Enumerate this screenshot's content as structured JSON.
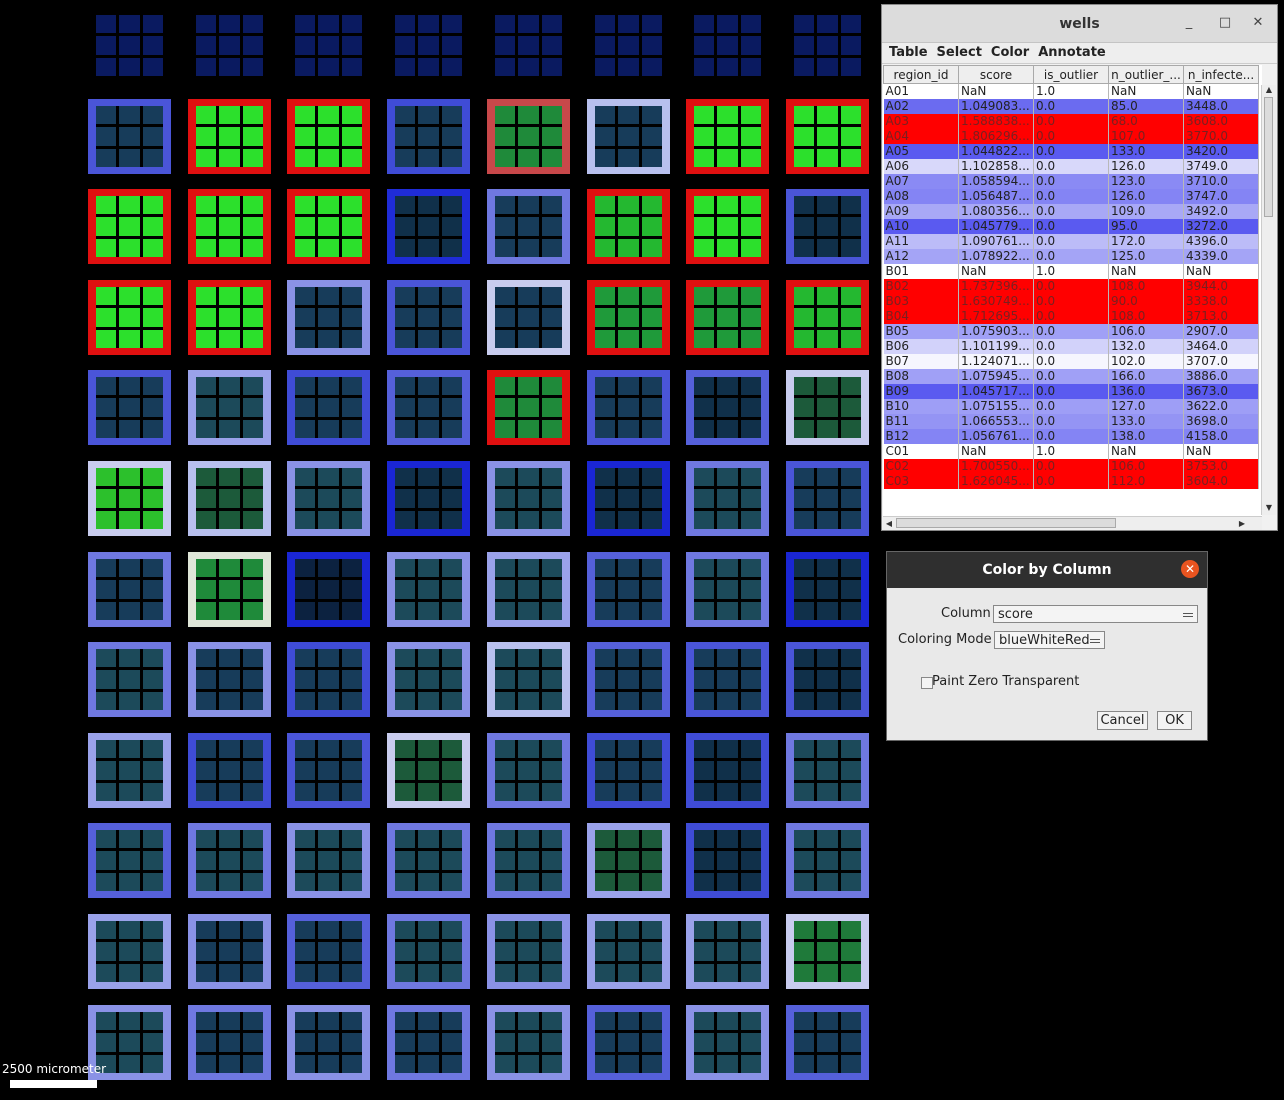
{
  "plate": {
    "scale_label": "2500 micrometer",
    "wells": [
      {
        "id": "r0c0",
        "row": 0,
        "col": 0,
        "frame": "#000000",
        "fill": "#0a1a60"
      },
      {
        "id": "r0c1",
        "row": 0,
        "col": 1,
        "frame": "#000000",
        "fill": "#0a1a60"
      },
      {
        "id": "r0c2",
        "row": 0,
        "col": 2,
        "frame": "#000000",
        "fill": "#0a1a60"
      },
      {
        "id": "r0c3",
        "row": 0,
        "col": 3,
        "frame": "#000000",
        "fill": "#0a1a60"
      },
      {
        "id": "r0c4",
        "row": 0,
        "col": 4,
        "frame": "#000000",
        "fill": "#0a1a60"
      },
      {
        "id": "r0c5",
        "row": 0,
        "col": 5,
        "frame": "#000000",
        "fill": "#0a1a60"
      },
      {
        "id": "r0c6",
        "row": 0,
        "col": 6,
        "frame": "#000000",
        "fill": "#0a1a60"
      },
      {
        "id": "r0c7",
        "row": 0,
        "col": 7,
        "frame": "#000000",
        "fill": "#0a1a60"
      },
      {
        "id": "r1c0",
        "row": 1,
        "col": 0,
        "frame": "#4a55d8",
        "fill": "#173c5a"
      },
      {
        "id": "r1c1",
        "row": 1,
        "col": 1,
        "frame": "#e01010",
        "fill": "#2ce02c"
      },
      {
        "id": "r1c2",
        "row": 1,
        "col": 2,
        "frame": "#e01010",
        "fill": "#2ce02c"
      },
      {
        "id": "r1c3",
        "row": 1,
        "col": 3,
        "frame": "#3f4cd6",
        "fill": "#173c5a"
      },
      {
        "id": "r1c4",
        "row": 1,
        "col": 4,
        "frame": "#c8484a",
        "fill": "#1f8a3a"
      },
      {
        "id": "r1c5",
        "row": 1,
        "col": 5,
        "frame": "#b8c0ee",
        "fill": "#173c5a"
      },
      {
        "id": "r1c6",
        "row": 1,
        "col": 6,
        "frame": "#e01010",
        "fill": "#2ce02c"
      },
      {
        "id": "r1c7",
        "row": 1,
        "col": 7,
        "frame": "#e01010",
        "fill": "#2ce02c"
      },
      {
        "id": "r2c0",
        "row": 2,
        "col": 0,
        "frame": "#e01010",
        "fill": "#2ce02c"
      },
      {
        "id": "r2c1",
        "row": 2,
        "col": 1,
        "frame": "#e01010",
        "fill": "#2ce02c"
      },
      {
        "id": "r2c2",
        "row": 2,
        "col": 2,
        "frame": "#e01010",
        "fill": "#2ce02c"
      },
      {
        "id": "r2c3",
        "row": 2,
        "col": 3,
        "frame": "#1f2cd8",
        "fill": "#10304a"
      },
      {
        "id": "r2c4",
        "row": 2,
        "col": 4,
        "frame": "#6f78e0",
        "fill": "#173c5a"
      },
      {
        "id": "r2c5",
        "row": 2,
        "col": 5,
        "frame": "#e01010",
        "fill": "#24b830"
      },
      {
        "id": "r2c6",
        "row": 2,
        "col": 6,
        "frame": "#e01010",
        "fill": "#2ce02c"
      },
      {
        "id": "r2c7",
        "row": 2,
        "col": 7,
        "frame": "#4a55d8",
        "fill": "#10304a"
      },
      {
        "id": "r3c0",
        "row": 3,
        "col": 0,
        "frame": "#e01010",
        "fill": "#2ce02c"
      },
      {
        "id": "r3c1",
        "row": 3,
        "col": 1,
        "frame": "#e01010",
        "fill": "#2ce02c"
      },
      {
        "id": "r3c2",
        "row": 3,
        "col": 2,
        "frame": "#8a92e6",
        "fill": "#173c5a"
      },
      {
        "id": "r3c3",
        "row": 3,
        "col": 3,
        "frame": "#4a55d8",
        "fill": "#173c5a"
      },
      {
        "id": "r3c4",
        "row": 3,
        "col": 4,
        "frame": "#c8ccee",
        "fill": "#173c5a"
      },
      {
        "id": "r3c5",
        "row": 3,
        "col": 5,
        "frame": "#e01010",
        "fill": "#1f9a3a"
      },
      {
        "id": "r3c6",
        "row": 3,
        "col": 6,
        "frame": "#e01010",
        "fill": "#1f9a3a"
      },
      {
        "id": "r3c7",
        "row": 3,
        "col": 7,
        "frame": "#e01010",
        "fill": "#24b830"
      },
      {
        "id": "r4c0",
        "row": 4,
        "col": 0,
        "frame": "#4a55d8",
        "fill": "#173c5a"
      },
      {
        "id": "r4c1",
        "row": 4,
        "col": 1,
        "frame": "#9aa2ea",
        "fill": "#1c4a5a"
      },
      {
        "id": "r4c2",
        "row": 4,
        "col": 2,
        "frame": "#3f4cd6",
        "fill": "#173c5a"
      },
      {
        "id": "r4c3",
        "row": 4,
        "col": 3,
        "frame": "#5560da",
        "fill": "#173c5a"
      },
      {
        "id": "r4c4",
        "row": 4,
        "col": 4,
        "frame": "#e01010",
        "fill": "#1f8a3a"
      },
      {
        "id": "r4c5",
        "row": 4,
        "col": 5,
        "frame": "#4a55d8",
        "fill": "#173c5a"
      },
      {
        "id": "r4c6",
        "row": 4,
        "col": 6,
        "frame": "#5560da",
        "fill": "#10304a"
      },
      {
        "id": "r4c7",
        "row": 4,
        "col": 7,
        "frame": "#c8ccee",
        "fill": "#1c5a3a"
      },
      {
        "id": "r5c0",
        "row": 5,
        "col": 0,
        "frame": "#c8ccee",
        "fill": "#2cc02c"
      },
      {
        "id": "r5c1",
        "row": 5,
        "col": 1,
        "frame": "#b8c0ee",
        "fill": "#1c5a3a"
      },
      {
        "id": "r5c2",
        "row": 5,
        "col": 2,
        "frame": "#8a92e6",
        "fill": "#1c4a5a"
      },
      {
        "id": "r5c3",
        "row": 5,
        "col": 3,
        "frame": "#1a26d4",
        "fill": "#10304a"
      },
      {
        "id": "r5c4",
        "row": 5,
        "col": 4,
        "frame": "#8a92e6",
        "fill": "#1c4a5a"
      },
      {
        "id": "r5c5",
        "row": 5,
        "col": 5,
        "frame": "#1a26d4",
        "fill": "#10304a"
      },
      {
        "id": "r5c6",
        "row": 5,
        "col": 6,
        "frame": "#6f78e0",
        "fill": "#1c4a5a"
      },
      {
        "id": "r5c7",
        "row": 5,
        "col": 7,
        "frame": "#4a55d8",
        "fill": "#173c5a"
      },
      {
        "id": "r6c0",
        "row": 6,
        "col": 0,
        "frame": "#6f78e0",
        "fill": "#173c5a"
      },
      {
        "id": "r6c1",
        "row": 6,
        "col": 1,
        "frame": "#dfe6d8",
        "fill": "#1f8a3a"
      },
      {
        "id": "r6c2",
        "row": 6,
        "col": 2,
        "frame": "#1a26d4",
        "fill": "#0c2240"
      },
      {
        "id": "r6c3",
        "row": 6,
        "col": 3,
        "frame": "#8a92e6",
        "fill": "#1c4a5a"
      },
      {
        "id": "r6c4",
        "row": 6,
        "col": 4,
        "frame": "#9aa2ea",
        "fill": "#1c4a5a"
      },
      {
        "id": "r6c5",
        "row": 6,
        "col": 5,
        "frame": "#5560da",
        "fill": "#173c5a"
      },
      {
        "id": "r6c6",
        "row": 6,
        "col": 6,
        "frame": "#6f78e0",
        "fill": "#1c4a5a"
      },
      {
        "id": "r6c7",
        "row": 6,
        "col": 7,
        "frame": "#1a26d4",
        "fill": "#10304a"
      },
      {
        "id": "r7c0",
        "row": 7,
        "col": 0,
        "frame": "#6f78e0",
        "fill": "#1c4a5a"
      },
      {
        "id": "r7c1",
        "row": 7,
        "col": 1,
        "frame": "#8a92e6",
        "fill": "#173c5a"
      },
      {
        "id": "r7c2",
        "row": 7,
        "col": 2,
        "frame": "#3f4cd6",
        "fill": "#173c5a"
      },
      {
        "id": "r7c3",
        "row": 7,
        "col": 3,
        "frame": "#8a92e6",
        "fill": "#1c4a5a"
      },
      {
        "id": "r7c4",
        "row": 7,
        "col": 4,
        "frame": "#b8c0ee",
        "fill": "#1c4a5a"
      },
      {
        "id": "r7c5",
        "row": 7,
        "col": 5,
        "frame": "#5560da",
        "fill": "#173c5a"
      },
      {
        "id": "r7c6",
        "row": 7,
        "col": 6,
        "frame": "#4a55d8",
        "fill": "#173c5a"
      },
      {
        "id": "r7c7",
        "row": 7,
        "col": 7,
        "frame": "#4a55d8",
        "fill": "#10304a"
      },
      {
        "id": "r8c0",
        "row": 8,
        "col": 0,
        "frame": "#9aa2ea",
        "fill": "#1c4a5a"
      },
      {
        "id": "r8c1",
        "row": 8,
        "col": 1,
        "frame": "#3f4cd6",
        "fill": "#173c5a"
      },
      {
        "id": "r8c2",
        "row": 8,
        "col": 2,
        "frame": "#4a55d8",
        "fill": "#173c5a"
      },
      {
        "id": "r8c3",
        "row": 8,
        "col": 3,
        "frame": "#c8ccee",
        "fill": "#1c5a3a"
      },
      {
        "id": "r8c4",
        "row": 8,
        "col": 4,
        "frame": "#6f78e0",
        "fill": "#1c4a5a"
      },
      {
        "id": "r8c5",
        "row": 8,
        "col": 5,
        "frame": "#3f4cd6",
        "fill": "#173c5a"
      },
      {
        "id": "r8c6",
        "row": 8,
        "col": 6,
        "frame": "#3f4cd6",
        "fill": "#10304a"
      },
      {
        "id": "r8c7",
        "row": 8,
        "col": 7,
        "frame": "#6f78e0",
        "fill": "#1c4a5a"
      },
      {
        "id": "r9c0",
        "row": 9,
        "col": 0,
        "frame": "#5560da",
        "fill": "#1c4a5a"
      },
      {
        "id": "r9c1",
        "row": 9,
        "col": 1,
        "frame": "#6f78e0",
        "fill": "#1c4a5a"
      },
      {
        "id": "r9c2",
        "row": 9,
        "col": 2,
        "frame": "#8a92e6",
        "fill": "#1c4a5a"
      },
      {
        "id": "r9c3",
        "row": 9,
        "col": 3,
        "frame": "#6f78e0",
        "fill": "#1c4a5a"
      },
      {
        "id": "r9c4",
        "row": 9,
        "col": 4,
        "frame": "#6f78e0",
        "fill": "#1c4a5a"
      },
      {
        "id": "r9c5",
        "row": 9,
        "col": 5,
        "frame": "#9aa2ea",
        "fill": "#1c5a3a"
      },
      {
        "id": "r9c6",
        "row": 9,
        "col": 6,
        "frame": "#3f4cd6",
        "fill": "#10304a"
      },
      {
        "id": "r9c7",
        "row": 9,
        "col": 7,
        "frame": "#6f78e0",
        "fill": "#1c4a5a"
      },
      {
        "id": "r10c0",
        "row": 10,
        "col": 0,
        "frame": "#9aa2ea",
        "fill": "#1c4a5a"
      },
      {
        "id": "r10c1",
        "row": 10,
        "col": 1,
        "frame": "#8a92e6",
        "fill": "#173c5a"
      },
      {
        "id": "r10c2",
        "row": 10,
        "col": 2,
        "frame": "#5560da",
        "fill": "#173c5a"
      },
      {
        "id": "r10c3",
        "row": 10,
        "col": 3,
        "frame": "#6f78e0",
        "fill": "#1c4a5a"
      },
      {
        "id": "r10c4",
        "row": 10,
        "col": 4,
        "frame": "#8a92e6",
        "fill": "#1c4a5a"
      },
      {
        "id": "r10c5",
        "row": 10,
        "col": 5,
        "frame": "#9aa2ea",
        "fill": "#1c4a5a"
      },
      {
        "id": "r10c6",
        "row": 10,
        "col": 6,
        "frame": "#9aa2ea",
        "fill": "#1c4a5a"
      },
      {
        "id": "r10c7",
        "row": 10,
        "col": 7,
        "frame": "#c8ccee",
        "fill": "#1f7a3a"
      },
      {
        "id": "r11c0",
        "row": 11,
        "col": 0,
        "frame": "#8a92e6",
        "fill": "#1c4a5a"
      },
      {
        "id": "r11c1",
        "row": 11,
        "col": 1,
        "frame": "#6f78e0",
        "fill": "#173c5a"
      },
      {
        "id": "r11c2",
        "row": 11,
        "col": 2,
        "frame": "#8a92e6",
        "fill": "#173c5a"
      },
      {
        "id": "r11c3",
        "row": 11,
        "col": 3,
        "frame": "#6f78e0",
        "fill": "#173c5a"
      },
      {
        "id": "r11c4",
        "row": 11,
        "col": 4,
        "frame": "#8a92e6",
        "fill": "#1c4a5a"
      },
      {
        "id": "r11c5",
        "row": 11,
        "col": 5,
        "frame": "#5560da",
        "fill": "#173c5a"
      },
      {
        "id": "r11c6",
        "row": 11,
        "col": 6,
        "frame": "#8a92e6",
        "fill": "#1c4a5a"
      },
      {
        "id": "r11c7",
        "row": 11,
        "col": 7,
        "frame": "#5560da",
        "fill": "#173c5a"
      }
    ]
  },
  "table_window": {
    "title": "wells",
    "controls": {
      "minimize": "_",
      "maximize": "□",
      "close": "✕"
    },
    "menus": [
      "Table",
      "Select",
      "Color",
      "Annotate"
    ],
    "columns": [
      "region_id",
      "score",
      "is_outlier",
      "n_outlier_...",
      "n_infecte..."
    ],
    "rows": [
      {
        "cells": [
          "A01",
          "NaN",
          "1.0",
          "NaN",
          "NaN"
        ],
        "bg": "#ffffff",
        "fg": "#222222"
      },
      {
        "cells": [
          "A02",
          "1.049083...",
          "0.0",
          "85.0",
          "3448.0"
        ],
        "bg": "#6b6bf0",
        "fg": "#222222"
      },
      {
        "cells": [
          "A03",
          "1.588838...",
          "0.0",
          "68.0",
          "3608.0"
        ],
        "bg": "#ff0000",
        "fg": "#7a2020"
      },
      {
        "cells": [
          "A04",
          "1.806296...",
          "0.0",
          "107.0",
          "3770.0"
        ],
        "bg": "#ff0000",
        "fg": "#7a2020"
      },
      {
        "cells": [
          "A05",
          "1.044822...",
          "0.0",
          "133.0",
          "3420.0"
        ],
        "bg": "#5a5af0",
        "fg": "#222222"
      },
      {
        "cells": [
          "A06",
          "1.102858...",
          "0.0",
          "126.0",
          "3749.0"
        ],
        "bg": "#d8d8fa",
        "fg": "#222222"
      },
      {
        "cells": [
          "A07",
          "1.058594...",
          "0.0",
          "123.0",
          "3710.0"
        ],
        "bg": "#8a8af4",
        "fg": "#222222"
      },
      {
        "cells": [
          "A08",
          "1.056487...",
          "0.0",
          "126.0",
          "3747.0"
        ],
        "bg": "#8484f4",
        "fg": "#222222"
      },
      {
        "cells": [
          "A09",
          "1.080356...",
          "0.0",
          "109.0",
          "3492.0"
        ],
        "bg": "#a8a8f6",
        "fg": "#222222"
      },
      {
        "cells": [
          "A10",
          "1.045779...",
          "0.0",
          "95.0",
          "3272.0"
        ],
        "bg": "#5a5af0",
        "fg": "#222222"
      },
      {
        "cells": [
          "A11",
          "1.090761...",
          "0.0",
          "172.0",
          "4396.0"
        ],
        "bg": "#bcbcf8",
        "fg": "#222222"
      },
      {
        "cells": [
          "A12",
          "1.078922...",
          "0.0",
          "125.0",
          "4339.0"
        ],
        "bg": "#a4a4f6",
        "fg": "#222222"
      },
      {
        "cells": [
          "B01",
          "NaN",
          "1.0",
          "NaN",
          "NaN"
        ],
        "bg": "#ffffff",
        "fg": "#222222"
      },
      {
        "cells": [
          "B02",
          "1.737396...",
          "0.0",
          "108.0",
          "3944.0"
        ],
        "bg": "#ff0000",
        "fg": "#7a2020"
      },
      {
        "cells": [
          "B03",
          "1.630749...",
          "0.0",
          "90.0",
          "3338.0"
        ],
        "bg": "#ff0000",
        "fg": "#7a2020"
      },
      {
        "cells": [
          "B04",
          "1.712695...",
          "0.0",
          "108.0",
          "3713.0"
        ],
        "bg": "#ff0000",
        "fg": "#7a2020"
      },
      {
        "cells": [
          "B05",
          "1.075903...",
          "0.0",
          "106.0",
          "2907.0"
        ],
        "bg": "#a0a0f6",
        "fg": "#222222"
      },
      {
        "cells": [
          "B06",
          "1.101199...",
          "0.0",
          "132.0",
          "3464.0"
        ],
        "bg": "#d2d2fa",
        "fg": "#222222"
      },
      {
        "cells": [
          "B07",
          "1.124071...",
          "0.0",
          "102.0",
          "3707.0"
        ],
        "bg": "#f6f6fe",
        "fg": "#222222"
      },
      {
        "cells": [
          "B08",
          "1.075945...",
          "0.0",
          "166.0",
          "3886.0"
        ],
        "bg": "#a0a0f6",
        "fg": "#222222"
      },
      {
        "cells": [
          "B09",
          "1.045717...",
          "0.0",
          "136.0",
          "3673.0"
        ],
        "bg": "#5a5af0",
        "fg": "#222222"
      },
      {
        "cells": [
          "B10",
          "1.075155...",
          "0.0",
          "127.0",
          "3622.0"
        ],
        "bg": "#9e9ef6",
        "fg": "#222222"
      },
      {
        "cells": [
          "B11",
          "1.066553...",
          "0.0",
          "133.0",
          "3698.0"
        ],
        "bg": "#9494f4",
        "fg": "#222222"
      },
      {
        "cells": [
          "B12",
          "1.056761...",
          "0.0",
          "138.0",
          "4158.0"
        ],
        "bg": "#8484f4",
        "fg": "#222222"
      },
      {
        "cells": [
          "C01",
          "NaN",
          "1.0",
          "NaN",
          "NaN"
        ],
        "bg": "#ffffff",
        "fg": "#222222"
      },
      {
        "cells": [
          "C02",
          "1.700550...",
          "0.0",
          "106.0",
          "3753.0"
        ],
        "bg": "#ff0000",
        "fg": "#7a2020"
      },
      {
        "cells": [
          "C03",
          "1.626045...",
          "0.0",
          "112.0",
          "3604.0"
        ],
        "bg": "#ff0000",
        "fg": "#7a2020"
      }
    ]
  },
  "color_dialog": {
    "title": "Color by Column",
    "column_label": "Column",
    "column_value": "score",
    "mode_label": "Coloring Mode",
    "mode_value": "blueWhiteRed",
    "checkbox_label": "Paint Zero Transparent",
    "checkbox_checked": false,
    "cancel_label": "Cancel",
    "ok_label": "OK"
  }
}
